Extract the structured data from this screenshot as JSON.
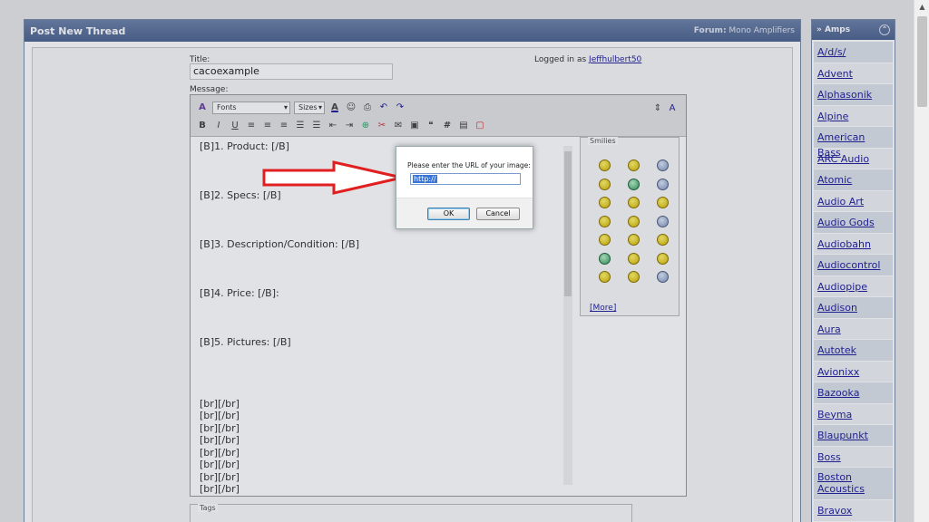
{
  "main": {
    "title": "Post New Thread",
    "forum_label": "Forum:",
    "forum_name": "Mono Amplifiers",
    "title_label": "Title:",
    "title_value": "cacoexample",
    "message_label": "Message:",
    "logged_in_text": "Logged in as",
    "username": "Jeffhulbert50",
    "tags_label": "Tags"
  },
  "toolbar": {
    "fonts_label": "Fonts",
    "sizes_label": "Sizes"
  },
  "message_lines": [
    "[B]1. Product: [/B]",
    "",
    "",
    "",
    "[B]2. Specs: [/B]",
    "",
    "",
    "",
    "[B]3. Description/Condition: [/B]",
    "",
    "",
    "",
    "[B]4. Price: [/B]:",
    "",
    "",
    "",
    "[B]5. Pictures: [/B]",
    "",
    "",
    "",
    "",
    "[br][/br]",
    "[br][/br]",
    "[br][/br]",
    "[br][/br]",
    "[br][/br]",
    "[br][/br]",
    "[br][/br]",
    "[br][/br]"
  ],
  "smilies": {
    "label": "Smilies",
    "more_label": "[More]"
  },
  "sidebar": {
    "title": "» Amps",
    "toggle_icon": "collapse-icon",
    "brands": [
      "A/d/s/",
      "Advent",
      "Alphasonik",
      "Alpine",
      "American Bass",
      "ARC Audio",
      "Atomic",
      "Audio Art",
      "Audio Gods",
      "Audiobahn",
      "Audiocontrol",
      "Audiopipe",
      "Audison",
      "Aura",
      "Autotek",
      "Avionixx",
      "Bazooka",
      "Beyma",
      "Blaupunkt",
      "Boss",
      "Boston Acoustics",
      "Bravox"
    ]
  },
  "dialog": {
    "prompt": "Please enter the URL of your image:",
    "input_value": "http://",
    "ok_label": "OK",
    "cancel_label": "Cancel"
  },
  "colors": {
    "header_blue": "#5a6f98",
    "annotation_red": "#e02020",
    "link": "#22229c"
  }
}
